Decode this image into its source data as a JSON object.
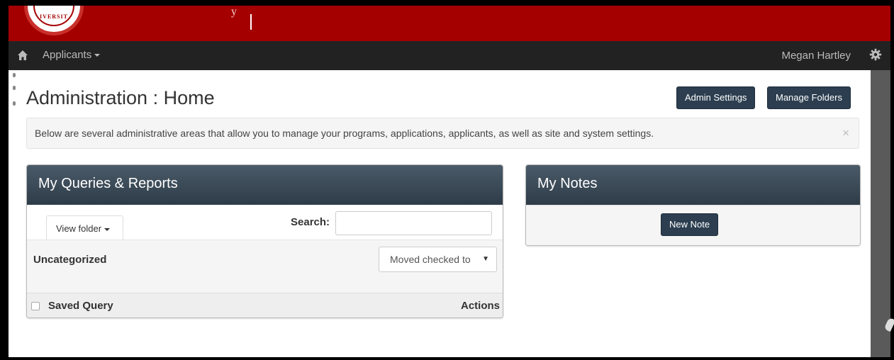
{
  "brand": {
    "seal_text": "IVERSIT"
  },
  "navbar": {
    "applicants_label": "Applicants",
    "user_name": "Megan Hartley"
  },
  "page": {
    "title": "Administration : Home",
    "admin_settings_label": "Admin Settings",
    "manage_folders_label": "Manage Folders",
    "info_text": "Below are several administrative areas that allow you to manage your programs, applications, applicants, as well as site and system settings.",
    "close_glyph": "×"
  },
  "queries_panel": {
    "title": "My Queries & Reports",
    "view_folder_label": "View folder",
    "search_label": "Search:",
    "search_value": "",
    "folder_name": "Uncategorized",
    "move_select_value": "Moved checked to",
    "columns": [
      "Saved Query",
      "Actions"
    ]
  },
  "notes_panel": {
    "title": "My Notes",
    "new_note_label": "New Note"
  },
  "colors": {
    "brand_red": "#a50000",
    "navbar": "#222222",
    "button_dark": "#2c3e50"
  }
}
